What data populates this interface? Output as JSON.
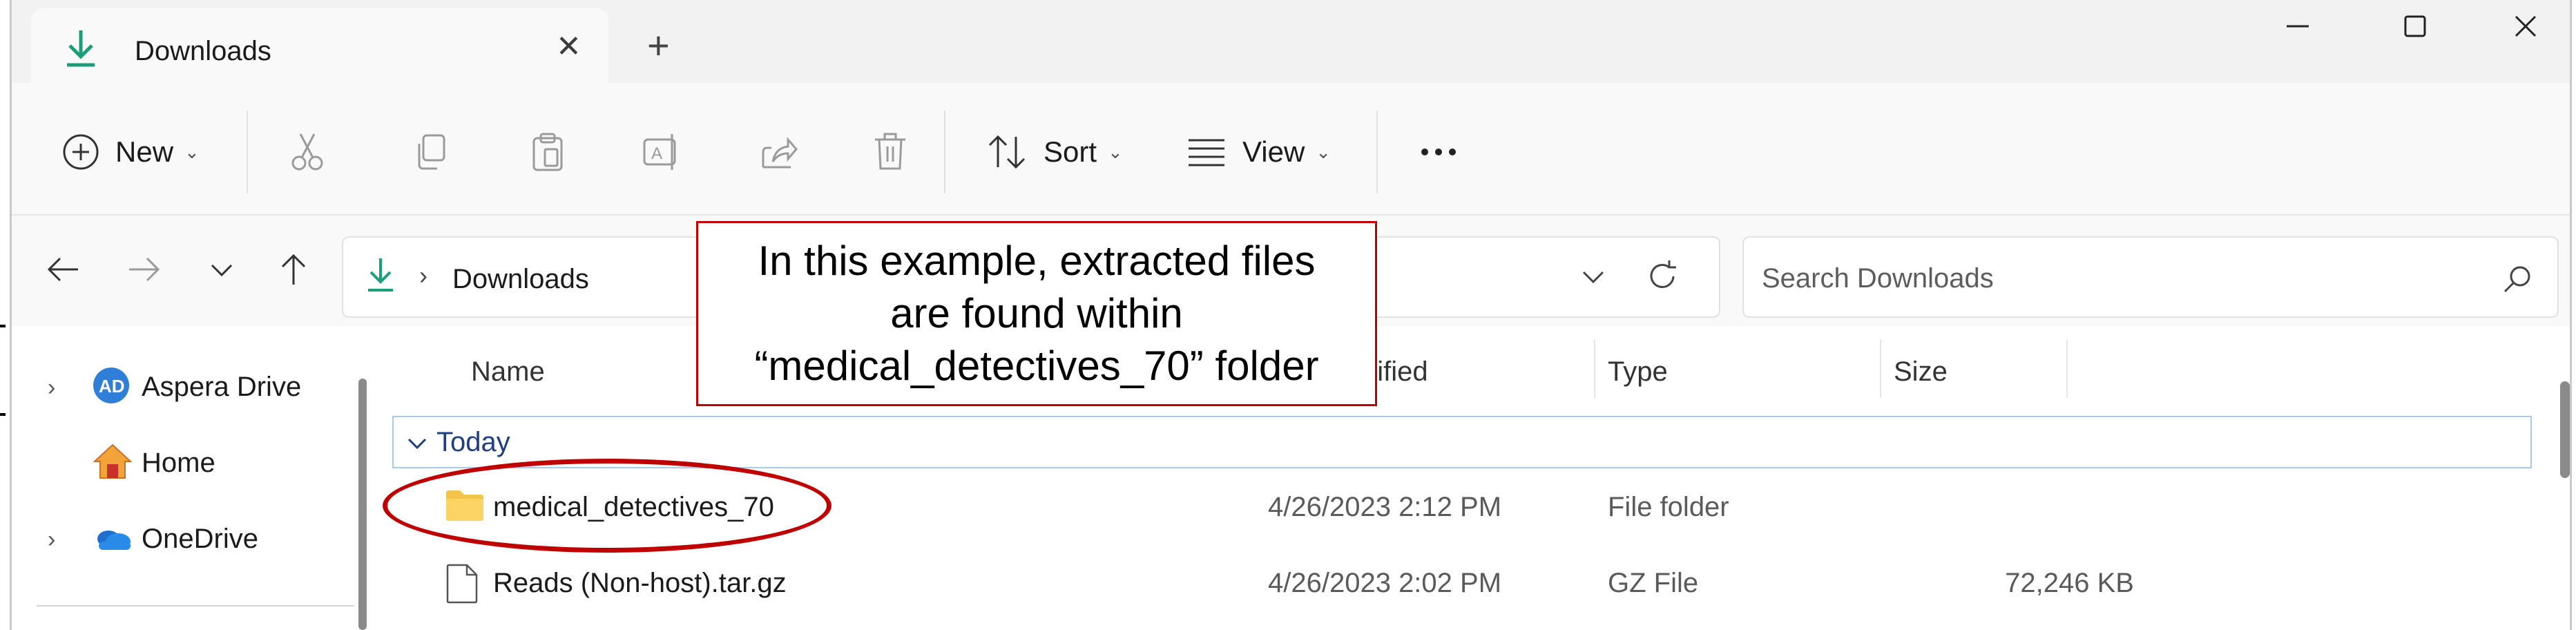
{
  "window": {
    "tab_title": "Downloads",
    "new_tab_glyph": "+",
    "close_tab_glyph": "✕",
    "controls": [
      "minimize",
      "maximize",
      "close"
    ]
  },
  "toolbar": {
    "new_label": "New",
    "sort_label": "Sort",
    "view_label": "View",
    "more_glyph": "···",
    "icons": [
      "plus-circle-icon",
      "cut-icon",
      "copy-icon",
      "paste-icon",
      "rename-icon",
      "share-icon",
      "delete-icon",
      "sort-icon",
      "view-icon",
      "more-icon"
    ]
  },
  "address": {
    "crumb_sep": "›",
    "crumb": "Downloads",
    "search_placeholder": "Search Downloads"
  },
  "nav_pane": {
    "items": [
      {
        "label": "Aspera Drive",
        "icon": "aspera-icon",
        "expandable": true
      },
      {
        "label": "Home",
        "icon": "home-icon",
        "expandable": false
      },
      {
        "label": "OneDrive",
        "icon": "onedrive-icon",
        "expandable": true
      }
    ]
  },
  "file_list": {
    "columns": [
      "Name",
      "dified",
      "Type",
      "Size"
    ],
    "group_label": "Today",
    "rows": [
      {
        "name": "medical_detectives_70",
        "date": "4/26/2023 2:12 PM",
        "type": "File folder",
        "size": "",
        "icon": "folder-icon"
      },
      {
        "name": "Reads (Non-host).tar.gz",
        "date": "4/26/2023 2:02 PM",
        "type": "GZ File",
        "size": "72,246 KB",
        "icon": "file-icon"
      }
    ]
  },
  "annotation": {
    "callout_line1": "In this example, extracted files",
    "callout_line2": "are found within",
    "callout_line3": "“medical_detectives_70” folder",
    "color": "#c00000"
  },
  "colors": {
    "accent_download": "#1a9e7a",
    "folder": "#f4c34a",
    "group_text": "#1f3f82"
  }
}
